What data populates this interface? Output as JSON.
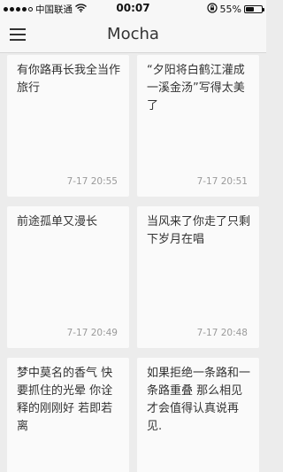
{
  "status_bar": {
    "carrier": "中国联通",
    "time": "00:07",
    "battery": "55%",
    "battery_level": 0.55
  },
  "nav": {
    "title": "Mocha"
  },
  "cards": [
    {
      "text": "有你路再长我全当作旅行",
      "time": "7-17 20:55"
    },
    {
      "text": "“夕阳将白鹤江灌成一溪金汤”写得太美了",
      "time": "7-17 20:51"
    },
    {
      "text": "前途孤单又漫长",
      "time": "7-17 20:49"
    },
    {
      "text": "当风来了你走了只剩下岁月在唱",
      "time": "7-17 20:48"
    },
    {
      "text": "梦中莫名的香气 快要抓住的光晕 你诠释的刚刚好 若即若离",
      "time": ""
    },
    {
      "text": "如果拒绝一条路和一条路重叠 那么相见才会值得认真说再见.",
      "time": ""
    }
  ]
}
